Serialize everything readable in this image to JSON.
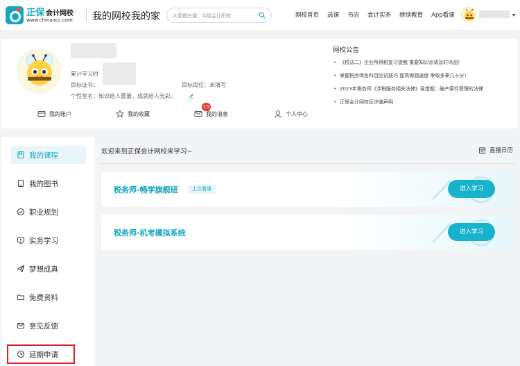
{
  "header": {
    "logo_cn": "正保",
    "logo_cn_em": "会计网校",
    "logo_url": "www.chinaacc.com",
    "site_title": "我的网校我的家",
    "search_placeholder": "大家都在搜：中级会计职称",
    "nav": [
      "网校首页",
      "选课",
      "书店",
      "会计实务",
      "继续教育",
      "App看课"
    ]
  },
  "profile": {
    "study_time_label": "累计学习时",
    "cert_label": "目标证书：",
    "position_text": "目标岗位：未填写",
    "signature_text": "个性签名：知识给人重量，成就给人光彩。",
    "quick_links": [
      "我的账户",
      "我的收藏",
      "我的消息",
      "个人中心"
    ],
    "message_badge": "15"
  },
  "notice": {
    "title": "网校公告",
    "items": [
      "《税法二》企业所得税复习提醒 重要知识点请及时巩固！",
      "掌握税务师各科目应试技巧 提高做题速度 争取多拿几十分！",
      "2023年税务师《涉税服务相关法律》易错题：破产案件受理的法律",
      "正保会计网校反诈骗声明"
    ]
  },
  "sidebar": {
    "items": [
      "我的课程",
      "我的图书",
      "职业规划",
      "实务学习",
      "梦想成真",
      "免费资料",
      "意见反馈",
      "延期申请"
    ]
  },
  "main": {
    "welcome": "欢迎来到正保会计网校来学习~",
    "calendar_label": "直播日历",
    "courses": [
      {
        "name": "税务师-畅学旗舰班",
        "tag": "上次看课",
        "button": "进入学习"
      },
      {
        "name": "税务师-机考模拟系统",
        "tag": "",
        "button": "进入学习"
      }
    ]
  },
  "colors": {
    "accent": "#12a6c4",
    "button": "#17b3cc",
    "highlight_border": "#e01d2a",
    "badge": "#e53935"
  }
}
